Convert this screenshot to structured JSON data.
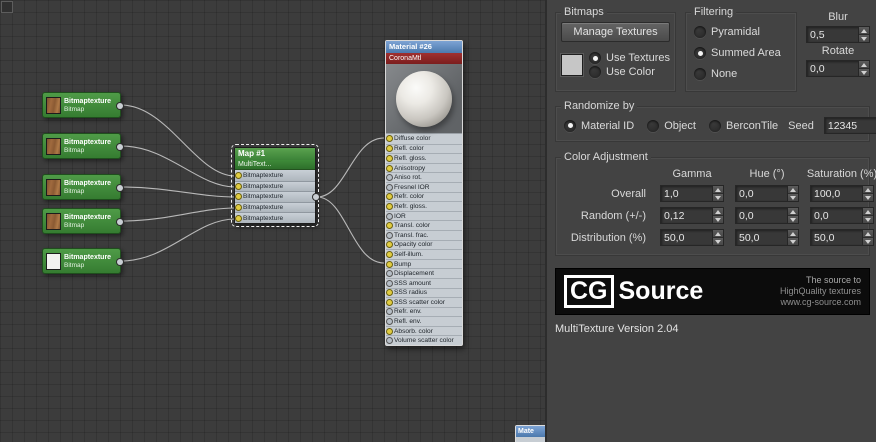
{
  "canvas": {
    "bitmap_nodes": [
      {
        "title": "Bitmaptexture",
        "subtitle": "Bitmap",
        "thumb": "wood"
      },
      {
        "title": "Bitmaptexture",
        "subtitle": "Bitmap",
        "thumb": "wood"
      },
      {
        "title": "Bitmaptexture",
        "subtitle": "Bitmap",
        "thumb": "wood"
      },
      {
        "title": "Bitmaptexture",
        "subtitle": "Bitmap",
        "thumb": "wood"
      },
      {
        "title": "Bitmaptexture",
        "subtitle": "Bitmap",
        "thumb": "blank"
      }
    ],
    "map_node": {
      "title": "Map #1",
      "subtitle": "MultiText...",
      "inputs": [
        "Bitmaptexture",
        "Bitmaptexture",
        "Bitmaptexture",
        "Bitmaptexture",
        "Bitmaptexture"
      ]
    },
    "material_node": {
      "title": "Material #26",
      "subtitle": "CoronaMtl",
      "slots": [
        {
          "label": "Diffuse color",
          "socket": "yellow"
        },
        {
          "label": "Refl. color",
          "socket": "yellow"
        },
        {
          "label": "Refl. gloss.",
          "socket": "yellow"
        },
        {
          "label": "Anisotropy",
          "socket": "yellow"
        },
        {
          "label": "Aniso rot.",
          "socket": "gray"
        },
        {
          "label": "Fresnel IOR",
          "socket": "gray"
        },
        {
          "label": "Refr. color",
          "socket": "yellow"
        },
        {
          "label": "Refr. gloss.",
          "socket": "yellow"
        },
        {
          "label": "IOR",
          "socket": "gray"
        },
        {
          "label": "Transl. color",
          "socket": "yellow"
        },
        {
          "label": "Transl. frac.",
          "socket": "gray"
        },
        {
          "label": "Opacity color",
          "socket": "yellow"
        },
        {
          "label": "Self-illum.",
          "socket": "yellow"
        },
        {
          "label": "Bump",
          "socket": "yellow"
        },
        {
          "label": "Displacement",
          "socket": "gray"
        },
        {
          "label": "SSS amount",
          "socket": "gray"
        },
        {
          "label": "SSS radius",
          "socket": "yellow"
        },
        {
          "label": "SSS scatter color",
          "socket": "yellow"
        },
        {
          "label": "Refr. env.",
          "socket": "gray"
        },
        {
          "label": "Refl. env.",
          "socket": "gray"
        },
        {
          "label": "Absorb. color",
          "socket": "yellow"
        },
        {
          "label": "Volume scatter color",
          "socket": "gray"
        }
      ]
    },
    "partial_node": {
      "title": "Mate"
    }
  },
  "panel": {
    "bitmaps": {
      "label": "Bitmaps",
      "manage_button": "Manage Textures",
      "use_textures": {
        "label": "Use Textures",
        "selected": true
      },
      "use_color": {
        "label": "Use Color",
        "selected": false
      }
    },
    "filtering": {
      "label": "Filtering",
      "options": [
        {
          "label": "Pyramidal",
          "selected": false
        },
        {
          "label": "Summed Area",
          "selected": true
        },
        {
          "label": "None",
          "selected": false
        }
      ]
    },
    "blur": {
      "label": "Blur",
      "value": "0,5"
    },
    "rotate": {
      "label": "Rotate",
      "value": "0,0"
    },
    "randomize": {
      "label": "Randomize by",
      "options": [
        {
          "label": "Material ID",
          "selected": true
        },
        {
          "label": "Object",
          "selected": false
        },
        {
          "label": "BerconTile",
          "selected": false
        }
      ],
      "seed_label": "Seed",
      "seed_value": "12345"
    },
    "color_adjustment": {
      "label": "Color Adjustment",
      "columns": [
        "Gamma",
        "Hue (°)",
        "Saturation (%)"
      ],
      "rows": [
        {
          "label": "Overall",
          "values": [
            "1,0",
            "0,0",
            "100,0"
          ]
        },
        {
          "label": "Random (+/-)",
          "values": [
            "0,12",
            "0,0",
            "0,0"
          ]
        },
        {
          "label": "Distribution (%)",
          "values": [
            "50,0",
            "50,0",
            "50,0"
          ]
        }
      ]
    },
    "logo": {
      "cg": "CG",
      "source": "Source",
      "lines": [
        "The source to",
        "HighQuality textures",
        "www.cg-source.com"
      ]
    },
    "version": "MultiTexture Version 2.04"
  }
}
